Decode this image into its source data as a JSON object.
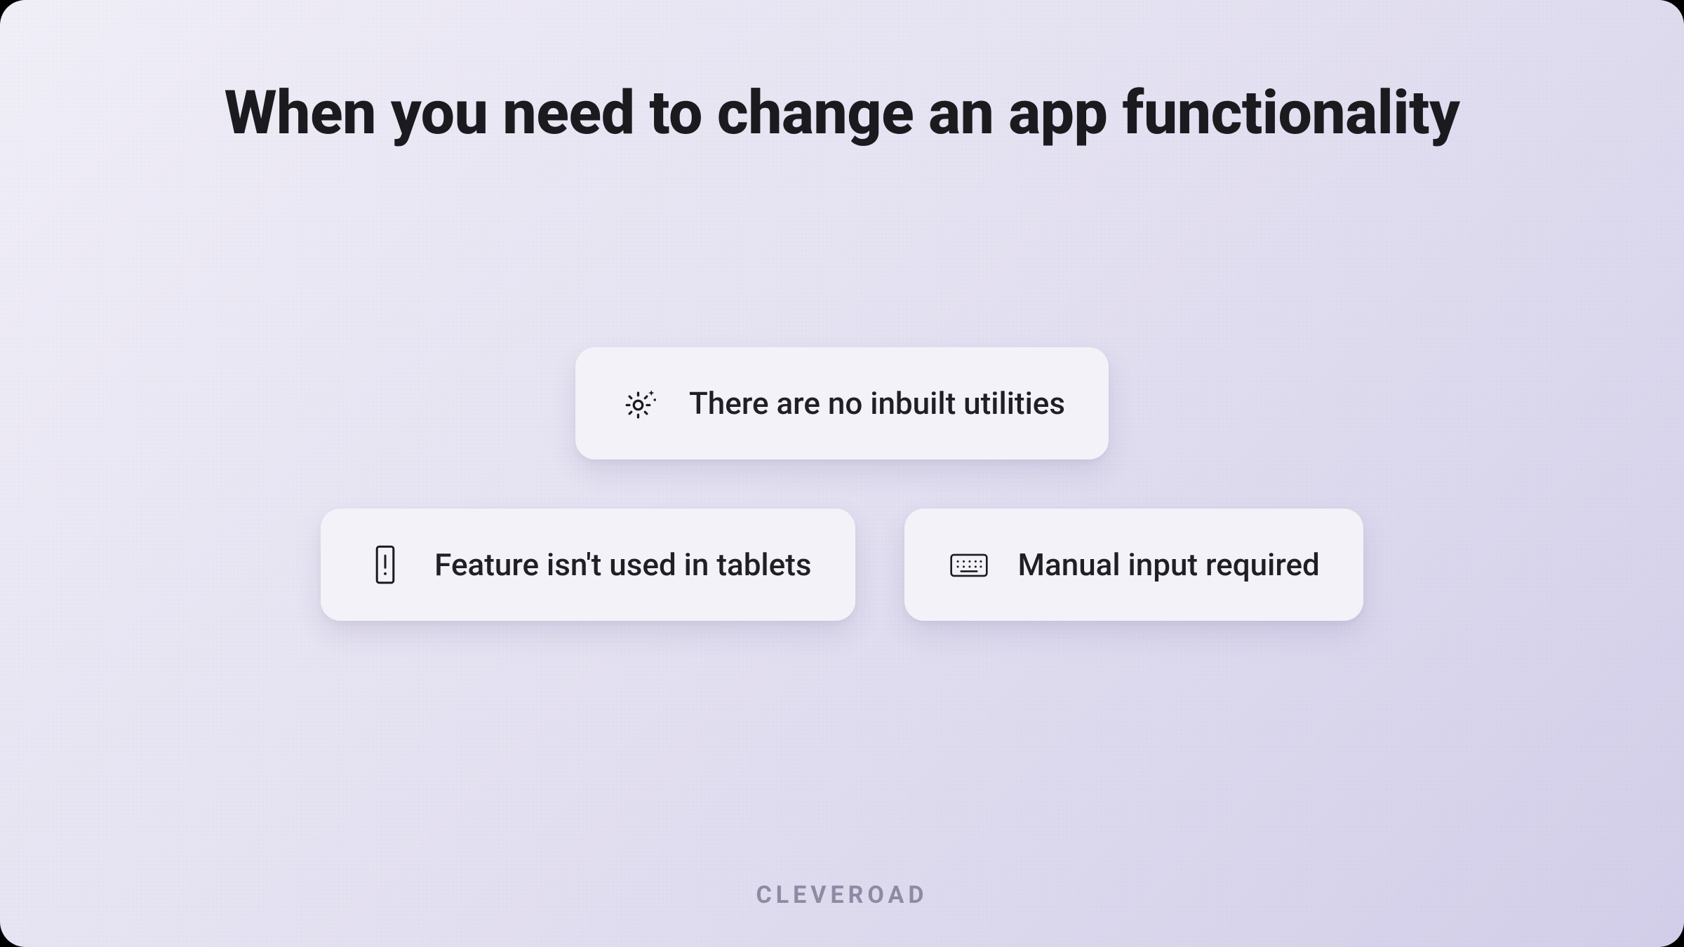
{
  "title": "When you need to change an app functionality",
  "cards": [
    {
      "label": "There are no inbuilt utilities",
      "icon": "gear-sparkle-icon"
    },
    {
      "label": "Feature isn't used in tablets",
      "icon": "phone-alert-icon"
    },
    {
      "label": "Manual input required",
      "icon": "keyboard-icon"
    }
  ],
  "brand": "CLEVEROAD",
  "colors": {
    "bgGradientStart": "#f0eef7",
    "bgGradientEnd": "#d2cee9",
    "cardBg": "#f3f2f8",
    "text": "#1b1b1f",
    "brandText": "#8d8aa3"
  }
}
